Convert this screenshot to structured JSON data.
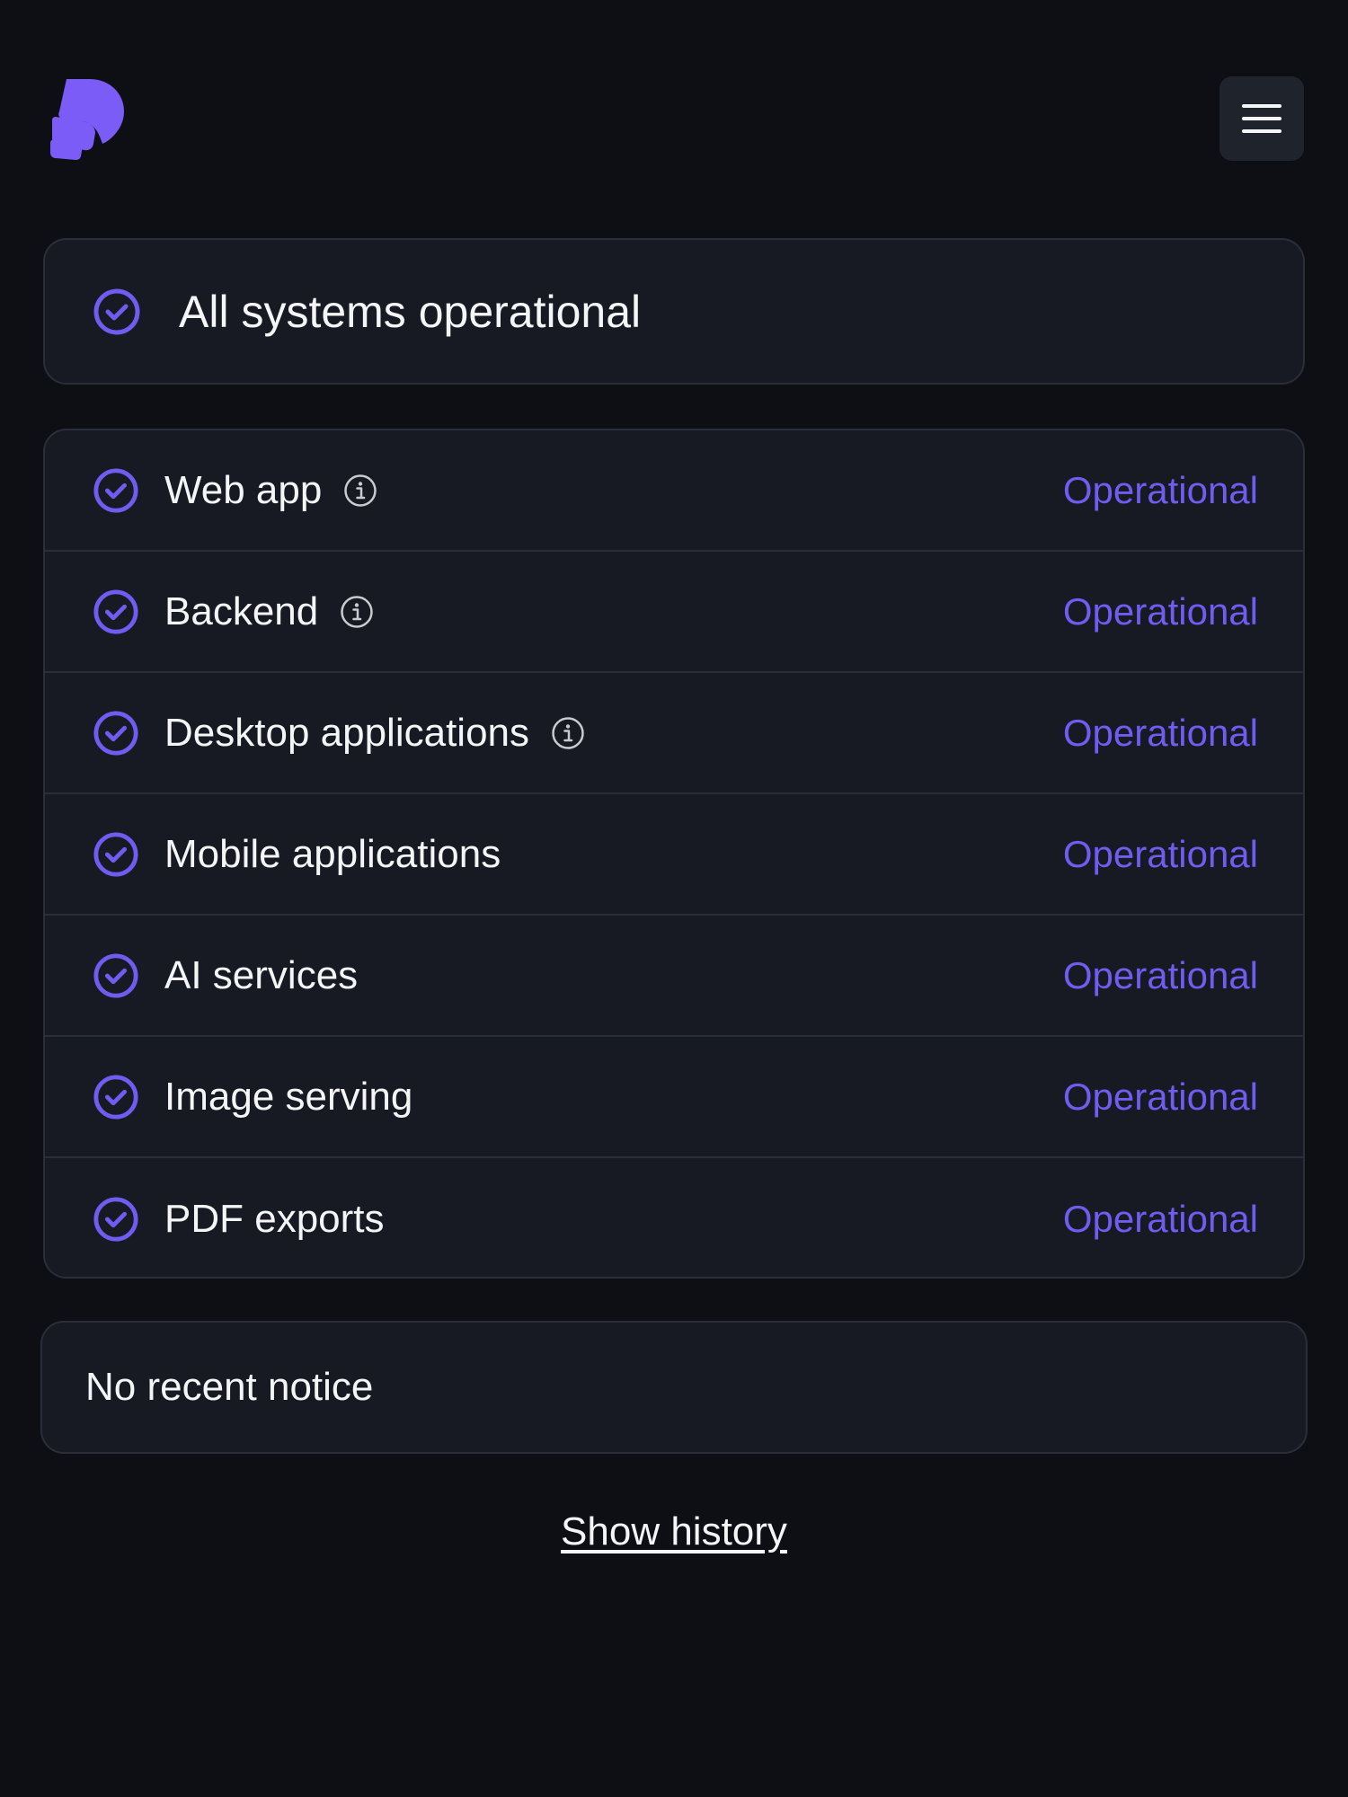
{
  "colors": {
    "background": "#0e0f14",
    "card": "#171a22",
    "border": "#2a2e38",
    "accent": "#6f5cf0",
    "text": "#f4f5f7"
  },
  "header": {
    "logo_icon": "brand-logo-icon",
    "menu_icon": "hamburger-menu-icon"
  },
  "summary": {
    "icon": "check-circle-icon",
    "title": "All systems operational"
  },
  "services": [
    {
      "name": "Web app",
      "status": "Operational",
      "has_info": true
    },
    {
      "name": "Backend",
      "status": "Operational",
      "has_info": true
    },
    {
      "name": "Desktop applications",
      "status": "Operational",
      "has_info": true
    },
    {
      "name": "Mobile applications",
      "status": "Operational",
      "has_info": false
    },
    {
      "name": "AI services",
      "status": "Operational",
      "has_info": false
    },
    {
      "name": "Image serving",
      "status": "Operational",
      "has_info": false
    },
    {
      "name": "PDF exports",
      "status": "Operational",
      "has_info": false
    }
  ],
  "notice": {
    "text": "No recent notice"
  },
  "history": {
    "label": "Show history"
  }
}
